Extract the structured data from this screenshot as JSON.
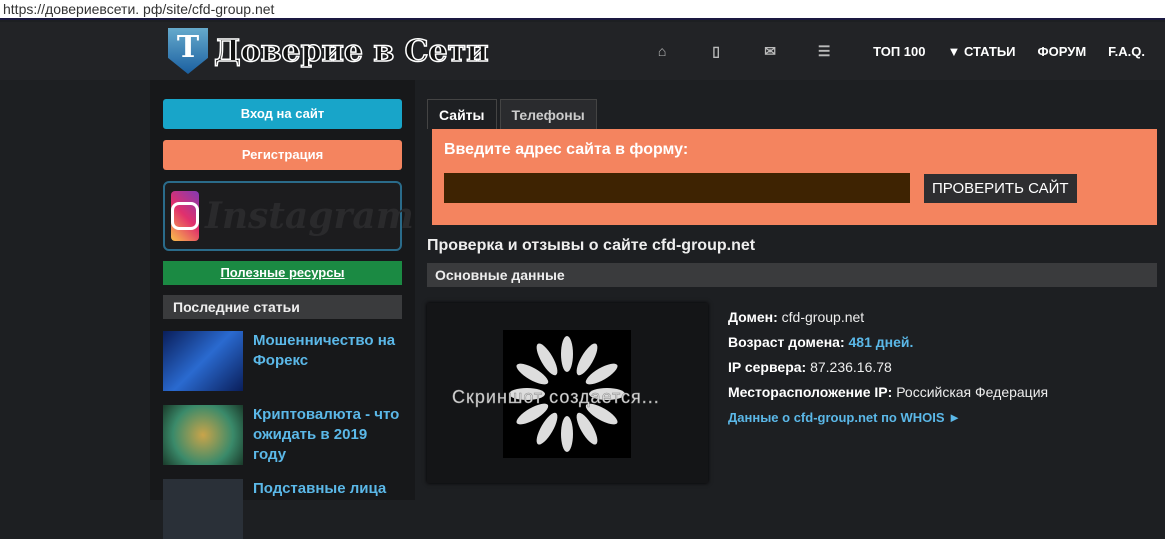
{
  "url": "https://довериевсети. рф/site/cfd-group.net",
  "logo": {
    "letter": "T",
    "text": "Доверие в Сети"
  },
  "nav": {
    "icons": [
      "home-icon",
      "phone-icon",
      "mail-icon",
      "list-icon"
    ],
    "links": [
      "ТОП 100",
      "▼ СТАТЬИ",
      "ФОРУМ",
      "F.A.Q."
    ]
  },
  "sidebar": {
    "login": "Вход на сайт",
    "register": "Регистрация",
    "instagram": "Instagram",
    "useful": "Полезные ресурсы",
    "latest": "Последние статьи",
    "articles": [
      {
        "title": "Мошенничество на Форекс"
      },
      {
        "title": "Криптовалюта - что ожидать в 2019 году"
      },
      {
        "title": "Подставные лица"
      }
    ]
  },
  "tabs": [
    "Сайты",
    "Телефоны"
  ],
  "form": {
    "title": "Введите адрес сайта в форму:",
    "value": "",
    "button": "ПРОВЕРИТЬ САЙТ"
  },
  "heading": "Проверка и отзывы о сайте cfd-group.net",
  "section": "Основные данные",
  "screenshot_caption": "Скриншот создается...",
  "info": {
    "domain_label": "Домен:",
    "domain": "cfd-group.net",
    "age_label": "Возраст домена:",
    "age": "481 дней.",
    "ip_label": "IP сервера:",
    "ip": "87.236.16.78",
    "loc_label": "Месторасположение IP:",
    "loc": "Российская Федерация",
    "whois": "Данные о cfd-group.net по WHOIS ►"
  }
}
